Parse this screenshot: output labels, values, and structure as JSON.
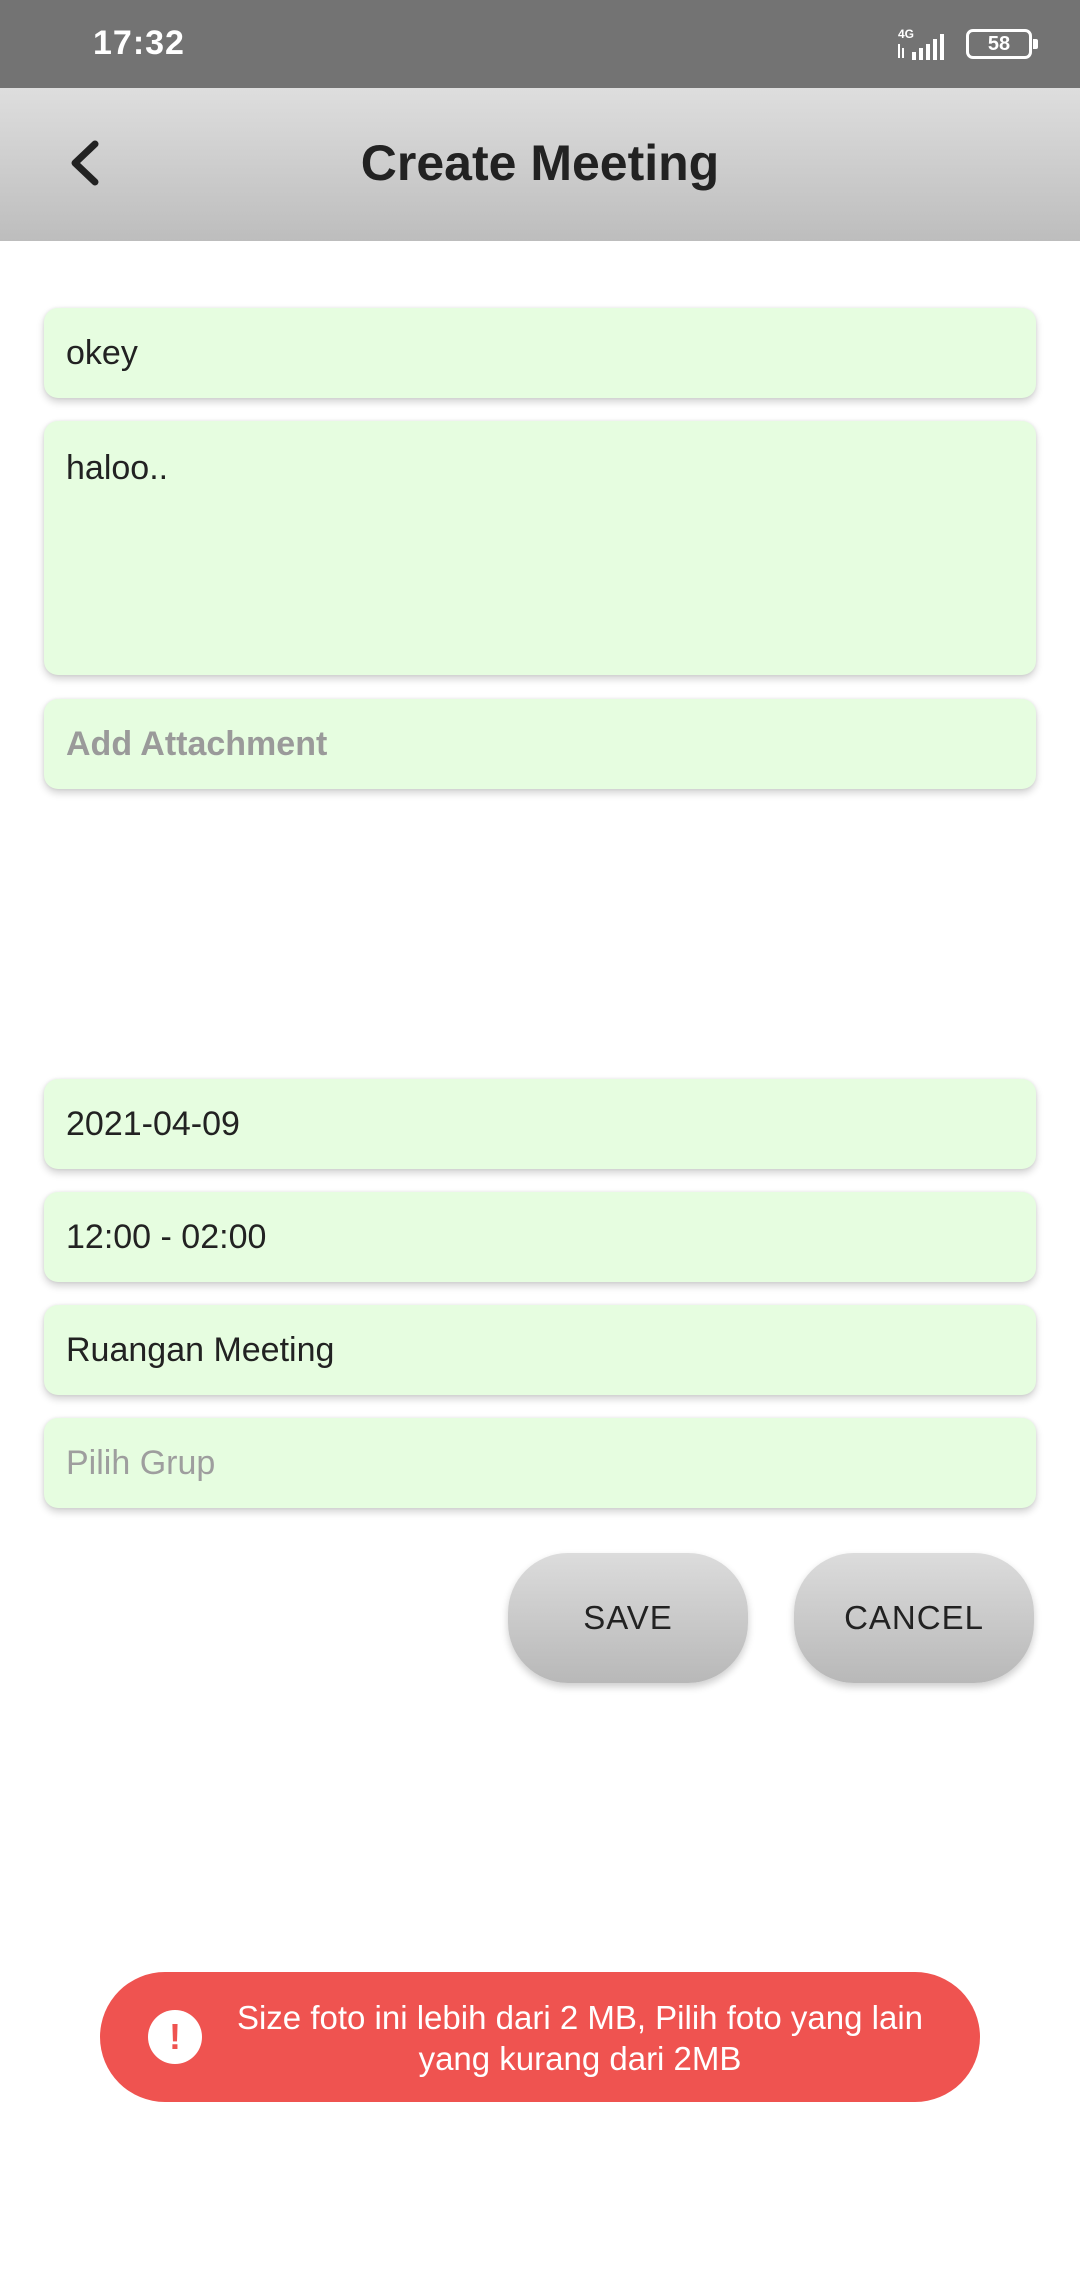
{
  "status_bar": {
    "time": "17:32",
    "network": "4G",
    "battery": "58",
    "signal_icon": "signal-bars-icon",
    "battery_icon": "battery-icon"
  },
  "app_bar": {
    "title": "Create Meeting",
    "back_icon": "chevron-left-icon"
  },
  "form": {
    "title_value": "okey",
    "description_value": "haloo..",
    "attachment_placeholder": "Add Attachment",
    "date_value": "2021-04-09",
    "time_value": "12:00 - 02:00",
    "room_value": "Ruangan Meeting",
    "group_placeholder": "Pilih Grup"
  },
  "buttons": {
    "save": "SAVE",
    "cancel": "CANCEL"
  },
  "toast": {
    "icon": "!",
    "message": "Size foto ini lebih dari 2 MB, Pilih foto yang lain yang kurang dari 2MB",
    "color": "#ef5350"
  },
  "colors": {
    "field_bg": "#e6fde0",
    "status_bar_bg": "#737373"
  }
}
